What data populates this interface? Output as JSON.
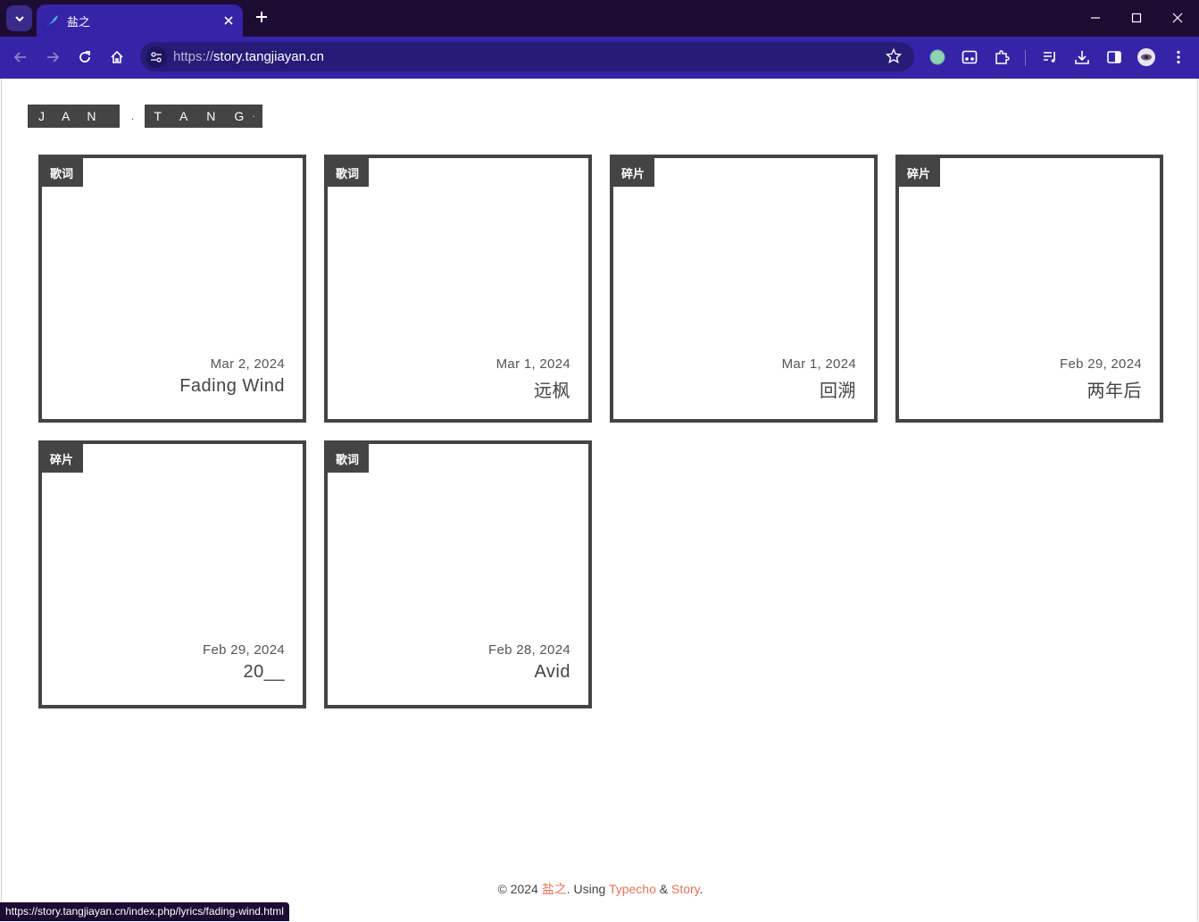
{
  "browser": {
    "tab_title": "盐之",
    "url_scheme": "https://",
    "url_host": "story.tangjiayan.cn",
    "status_url": "https://story.tangjiayan.cn/index.php/lyrics/fading-wind.html"
  },
  "site": {
    "logo_part1": "JAN",
    "logo_dot": ".",
    "logo_part2": "TANG",
    "logo_tail": "·"
  },
  "posts": [
    {
      "category": "歌词",
      "date": "Mar 2, 2024",
      "title": "Fading Wind"
    },
    {
      "category": "歌词",
      "date": "Mar 1, 2024",
      "title": "远枫"
    },
    {
      "category": "碎片",
      "date": "Mar 1, 2024",
      "title": "回溯"
    },
    {
      "category": "碎片",
      "date": "Feb 29, 2024",
      "title": "两年后"
    },
    {
      "category": "碎片",
      "date": "Feb 29, 2024",
      "title": "20__"
    },
    {
      "category": "歌词",
      "date": "Feb 28, 2024",
      "title": "Avid"
    }
  ],
  "footer": {
    "copyright": "© 2024 ",
    "author": "盐之",
    "using": ". Using ",
    "engine": "Typecho",
    "amp": " & ",
    "theme": "Story",
    "end": "."
  },
  "colors": {
    "titlebar": "#1c0c33",
    "toolbar": "#3623a8",
    "card_border": "#444444",
    "link": "#e8735a"
  }
}
